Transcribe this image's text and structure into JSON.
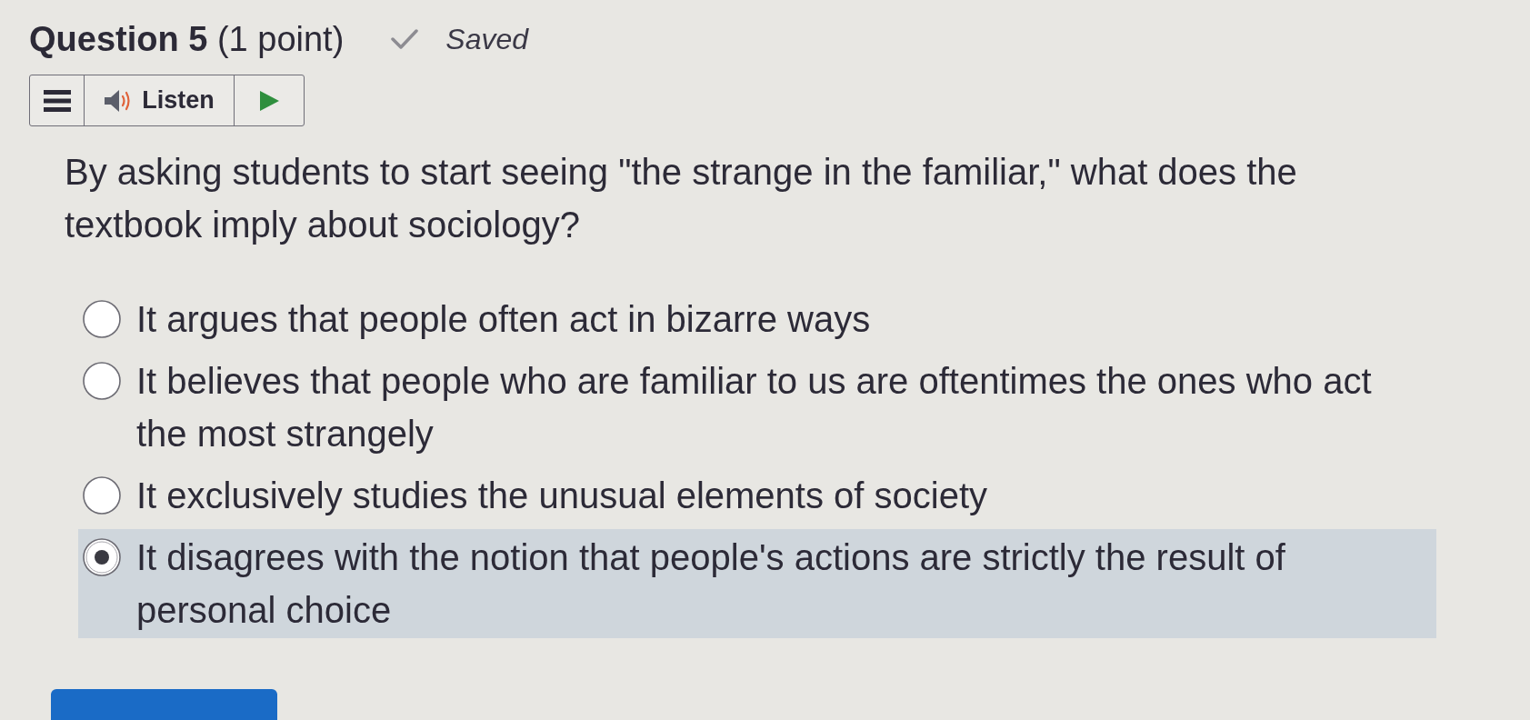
{
  "header": {
    "title": "**Question 5** (1 point)",
    "status": "Saved"
  },
  "toolbar": {
    "listen_label": "Listen"
  },
  "question": {
    "text": "By asking students to start seeing \"the strange in the familiar,\" what does the textbook imply about sociology?"
  },
  "options": [
    {
      "text": "It argues that people often act in bizarre ways",
      "selected": false
    },
    {
      "text": "It believes that people who are familiar to us are oftentimes the ones who act the most strangely",
      "selected": false
    },
    {
      "text": "It exclusively studies the unusual elements of society",
      "selected": false
    },
    {
      "text": "It disagrees with the notion that people's actions are strictly the result of personal choice",
      "selected": true
    }
  ]
}
